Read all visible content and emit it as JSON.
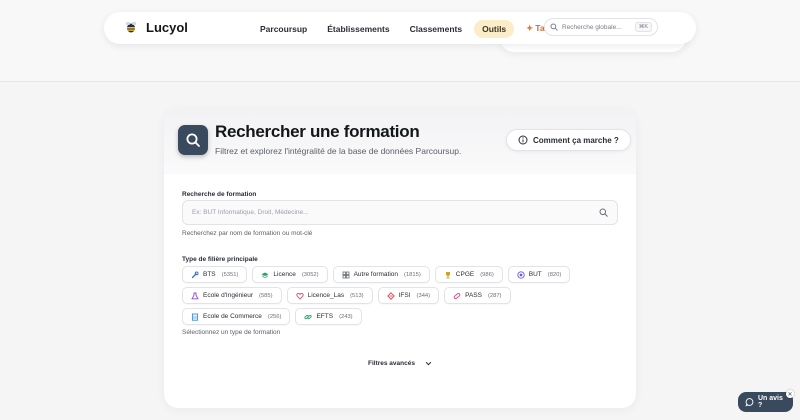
{
  "header": {
    "logo_text": "Lucyol",
    "nav": [
      {
        "label": "Parcoursup",
        "active": false
      },
      {
        "label": "Établissements",
        "active": false
      },
      {
        "label": "Classements",
        "active": false
      },
      {
        "label": "Outils",
        "active": true
      },
      {
        "label": "Tarifs",
        "active": false
      }
    ],
    "search_placeholder": "Recherche globale...",
    "search_shortcut": "⌘K"
  },
  "card": {
    "title": "Rechercher une formation",
    "subtitle": "Filtrez et explorez l'intégralité de la base de données Parcoursup.",
    "how_button": "Comment ça marche ?"
  },
  "search": {
    "label": "Recherche de formation",
    "placeholder": "Ex: BUT Informatique, Droit, Médecine...",
    "value": "",
    "hint": "Recherchez par nom de formation ou mot-clé"
  },
  "filiere": {
    "label": "Type de filière principale",
    "hint": "Sélectionnez un type de formation",
    "chips": [
      {
        "label": "BTS",
        "count": "(5351)",
        "icon": "wrench-icon",
        "color": "#3b6fd8"
      },
      {
        "label": "Licence",
        "count": "(3052)",
        "icon": "graduation-cap-icon",
        "color": "#2f9e6a"
      },
      {
        "label": "Autre formation",
        "count": "(1815)",
        "icon": "grid-icon",
        "color": "#6b6f79"
      },
      {
        "label": "CPGE",
        "count": "(986)",
        "icon": "trophy-icon",
        "color": "#d6a21e"
      },
      {
        "label": "BUT",
        "count": "(820)",
        "icon": "target-icon",
        "color": "#6a5ad8"
      },
      {
        "label": "Ecole d'Ingénieur",
        "count": "(585)",
        "icon": "flask-icon",
        "color": "#8a4fd0"
      },
      {
        "label": "Licence_Las",
        "count": "(513)",
        "icon": "heart-icon",
        "color": "#d8465a"
      },
      {
        "label": "IFSI",
        "count": "(344)",
        "icon": "diamond-icon",
        "color": "#d8465a"
      },
      {
        "label": "PASS",
        "count": "(287)",
        "icon": "pill-icon",
        "color": "#d84a8a"
      },
      {
        "label": "Ecole de Commerce",
        "count": "(256)",
        "icon": "building-icon",
        "color": "#3b8ad8"
      },
      {
        "label": "EFTS",
        "count": "(243)",
        "icon": "link-icon",
        "color": "#2f9e6a"
      }
    ]
  },
  "filters_toggle": "Filtres avancés",
  "feedback_label": "Un avis ?"
}
